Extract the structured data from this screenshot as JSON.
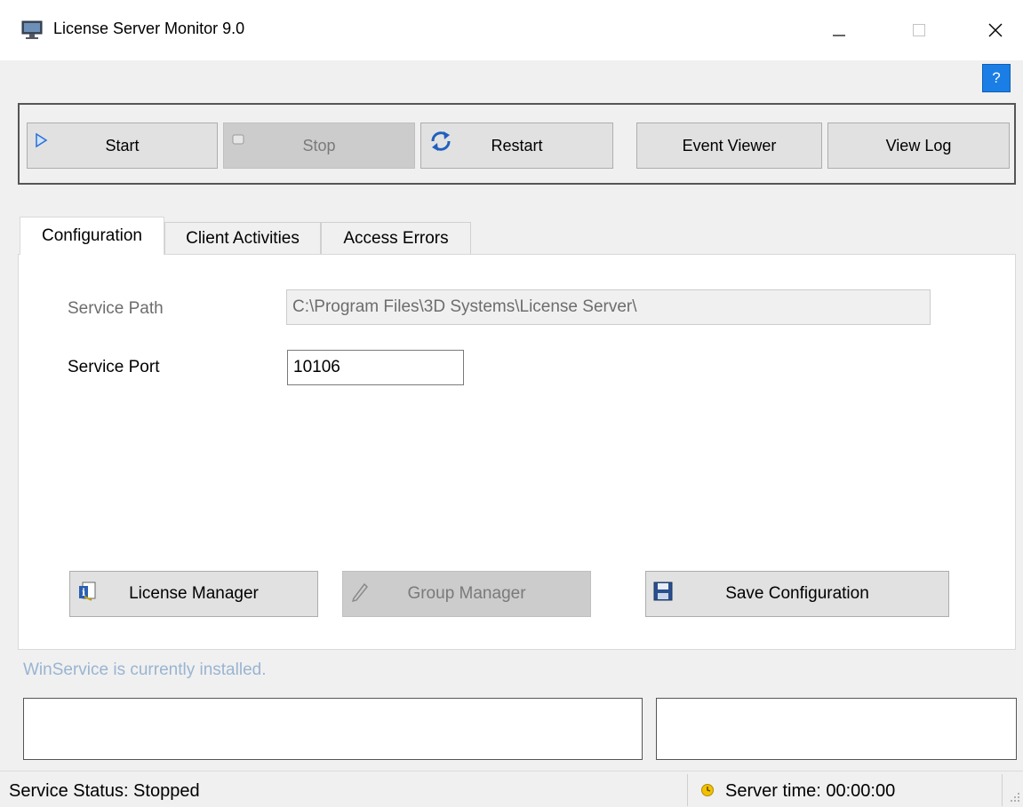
{
  "window": {
    "title": "License Server Monitor 9.0"
  },
  "help": {
    "label": "?"
  },
  "toolbar": {
    "start": "Start",
    "stop": "Stop",
    "restart": "Restart",
    "event_viewer": "Event Viewer",
    "view_log": "View Log"
  },
  "tabs": [
    {
      "label": "Configuration",
      "active": true
    },
    {
      "label": "Client Activities",
      "active": false
    },
    {
      "label": "Access Errors",
      "active": false
    }
  ],
  "config": {
    "service_path_label": "Service Path",
    "service_path_value": "C:\\Program Files\\3D Systems\\License Server\\",
    "service_port_label": "Service Port",
    "service_port_value": "10106"
  },
  "panel_buttons": {
    "license_manager": "License Manager",
    "group_manager": "Group Manager",
    "save_configuration": "Save Configuration"
  },
  "install_message": "WinService is currently installed.",
  "status": {
    "service_status": "Service Status: Stopped",
    "server_time": "Server time: 00:00:00"
  },
  "colors": {
    "accent": "#1a7ee6",
    "install_message": "#99b4d1"
  }
}
